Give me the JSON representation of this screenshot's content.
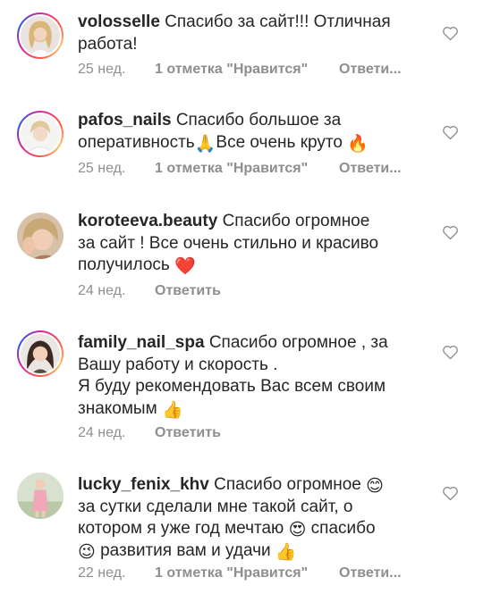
{
  "comments": [
    {
      "username": "volosselle",
      "text_lines": [
        "Спасибо за сайт!!! Отличная",
        "работа!"
      ],
      "time": "25 нед.",
      "likes": "1 отметка \"Нравится\"",
      "reply": "Ответи...",
      "avatar": "avatar-blonde-woman",
      "story_ring": true
    },
    {
      "username": "pafos_nails",
      "text_lines": [
        "Спасибо большое за",
        "оперативность",
        "Все очень круто"
      ],
      "emojis": [
        "🙏",
        "🔥"
      ],
      "time": "25 нед.",
      "likes": "1 отметка \"Нравится\"",
      "reply": "Ответи...",
      "avatar": "avatar-woman-white",
      "story_ring": true
    },
    {
      "username": "koroteeva.beauty",
      "text_lines": [
        "Спасибо огромное",
        "за сайт ! Все очень стильно и красиво",
        "получилось"
      ],
      "emojis": [
        "❤️"
      ],
      "time": "24 нед.",
      "reply": "Ответить",
      "avatar": "avatar-woman-hand",
      "story_ring": false
    },
    {
      "username": "family_nail_spa",
      "text_lines": [
        "Спасибо огромное , за",
        "Вашу работу и скорость .",
        "Я буду рекомендовать Вас всем своим",
        "знакомым"
      ],
      "emojis": [
        "👍"
      ],
      "time": "24 нед.",
      "reply": "Ответить",
      "avatar": "avatar-woman-dark-hair",
      "story_ring": true
    },
    {
      "username": "lucky_fenix_khv",
      "text_lines": [
        "Спасибо огромное",
        "за сутки сделали мне такой сайт, о",
        "котором я уже год мечтаю",
        "спасибо",
        "развития вам и удачи"
      ],
      "emojis": [
        "😊",
        "😍",
        "😉",
        "👍"
      ],
      "time": "22 нед.",
      "likes": "1 отметка \"Нравится\"",
      "reply": "Ответи...",
      "avatar": "avatar-woman-standing",
      "story_ring": false
    }
  ],
  "icons": {
    "like": "heart-outline-icon"
  },
  "colors": {
    "text": "#262626",
    "meta": "#8e8e8e"
  }
}
